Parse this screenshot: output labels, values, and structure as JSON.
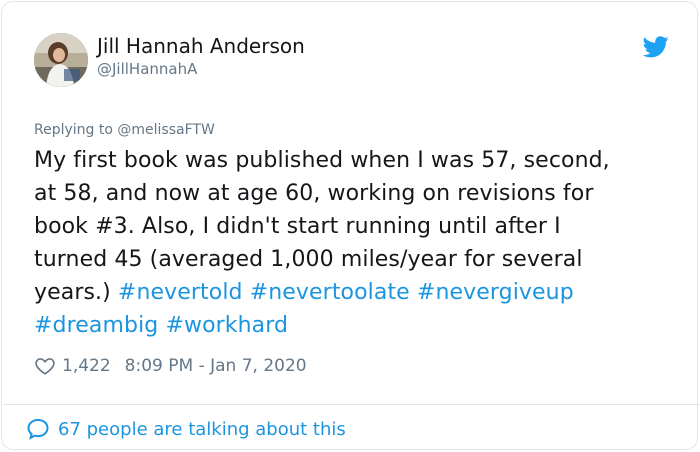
{
  "author": {
    "name": "Jill Hannah Anderson",
    "handle": "@JillHannahA"
  },
  "reply_context": {
    "prefix": "Replying to ",
    "mention": "@melissaFTW"
  },
  "tweet": {
    "lines": [
      "My first book was published when I was 57, second,",
      "at 58, and now at age 60, working on revisions for",
      "book #3. Also, I didn't start running until after I",
      "turned 45 (averaged 1,000 miles/year for several",
      "years.) "
    ],
    "hashtags": [
      "#nevertold",
      "#nevertoolate",
      "#nevergiveup",
      "#dreambig",
      "#workhard"
    ]
  },
  "meta": {
    "likes": "1,422",
    "timestamp": "8:09 PM - Jan 7, 2020"
  },
  "footer": {
    "talking": "67 people are talking about this"
  },
  "icons": {
    "brand": "twitter-bird-icon",
    "like": "heart-icon",
    "conversation": "speech-bubble-icon"
  },
  "colors": {
    "link": "#1b95e0",
    "muted": "#657786",
    "text": "#14171a",
    "border": "#e1e8ed"
  }
}
